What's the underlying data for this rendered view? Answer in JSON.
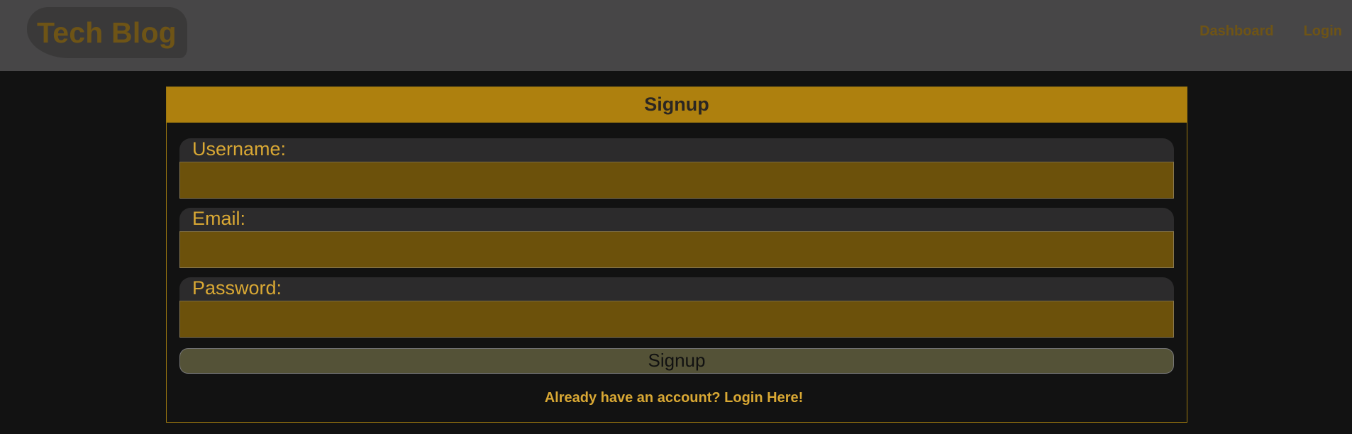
{
  "header": {
    "logo_text": "Tech Blog",
    "nav": {
      "dashboard_label": "Dashboard",
      "login_label": "Login"
    }
  },
  "signup_form": {
    "title": "Signup",
    "fields": [
      {
        "label": "Username:",
        "value": "",
        "type": "text"
      },
      {
        "label": "Email:",
        "value": "",
        "type": "email"
      },
      {
        "label": "Password:",
        "value": "",
        "type": "password"
      }
    ],
    "submit_label": "Signup",
    "login_link_text": "Already have an account? Login Here!"
  },
  "colors": {
    "page_background": "#121212",
    "header_background": "#474647",
    "accent_gold": "#ae800e",
    "label_text": "#d9a834",
    "input_background": "#6c510b",
    "button_background": "#545237"
  }
}
